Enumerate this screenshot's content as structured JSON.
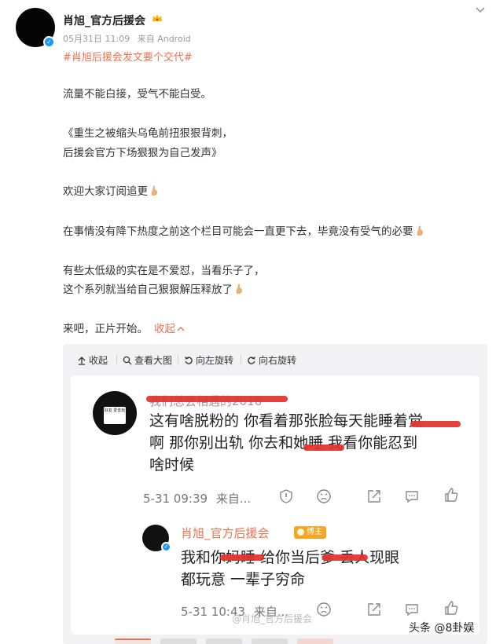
{
  "post": {
    "author": "肖旭_官方后援会",
    "date": "05月31日 11:09",
    "source": "来自 Android",
    "hashtag": "#肖旭后援会发文要个交代#",
    "lines": [
      "流量不能白接，受气不能白受。",
      "《重生之被缩头乌龟前扭狠狠背刺，",
      "后援会官方下场狠狠为自己发声》",
      "欢迎大家订阅追更",
      "在事情没有降下热度之前这个栏目可能会一直更下去，毕竟没有受气的必要",
      "有些太低级的实在是不爱怼，当看乐子了，",
      "这个系列就当给自己狠狠解压释放了",
      "来吧，正片开始。"
    ],
    "collapse_label": "收起"
  },
  "toolbar": {
    "collapse": "收起",
    "view_large": "查看大图",
    "rotate_left": "向左旋转",
    "rotate_right": "向右旋转"
  },
  "screenshot": {
    "comment_name": "我们总会相遇的2016",
    "avatar_caption": "好友 爱去玩",
    "comment_lines": [
      "这有啥脱粉的 你看着那张脸每天能睡着觉",
      "啊 那你别出轨 你去和她睡 我看你能忍到",
      "啥时候"
    ],
    "comment_time": "5-31 09:39",
    "comment_from": "来自...",
    "reply_name": "肖旭_官方后援会",
    "reply_badge": "博主",
    "reply_lines": [
      "我和你妈睡 给你当后爹 丢人现眼",
      "都玩意 一辈子穷命"
    ],
    "reply_time": "5-31 10:43",
    "reply_from": "来自..."
  },
  "watermark": "@肖旭_官方后援会",
  "brand": "头条 @8卦娱",
  "colors": {
    "accent": "#eb7350",
    "verify": "#1a9af5",
    "scribble": "#e2312b",
    "panel": "#f2f2f5"
  }
}
